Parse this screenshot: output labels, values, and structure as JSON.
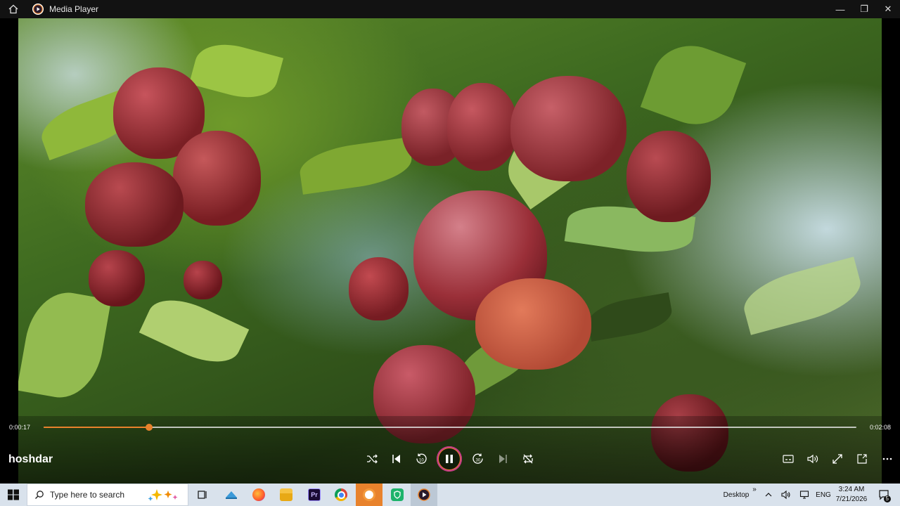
{
  "window": {
    "title": "Media Player",
    "minimize_glyph": "—",
    "maximize_glyph": "❐",
    "close_glyph": "✕"
  },
  "player": {
    "media_title": "hoshdar",
    "current_time": "0:00:17",
    "duration": "0:02:08",
    "progress_fraction": 0.13,
    "accent_color": "#e8822c",
    "state": "playing",
    "controls": [
      "shuffle-icon",
      "previous-icon",
      "rewind-10-icon",
      "pause-icon",
      "forward-30-icon",
      "next-icon",
      "repeat-off-icon"
    ],
    "right_controls": [
      "captions-icon",
      "volume-icon",
      "fullscreen-icon",
      "mini-player-icon",
      "more-icon"
    ]
  },
  "taskbar": {
    "search_placeholder": "Type here to search",
    "apps": [
      "task-view-icon",
      "cloud-app-icon",
      "firefox-icon",
      "file-explorer-icon",
      "premiere-pro-icon",
      "chrome-icon",
      "paint-app-icon",
      "vpn-shield-icon",
      "media-player-icon"
    ],
    "premiere_label": "Pr",
    "desktop_label": "Desktop",
    "overflow_glyph": "»",
    "language": "ENG",
    "time": "3:24 AM",
    "date": "7/21/2026",
    "notification_count": "5"
  }
}
